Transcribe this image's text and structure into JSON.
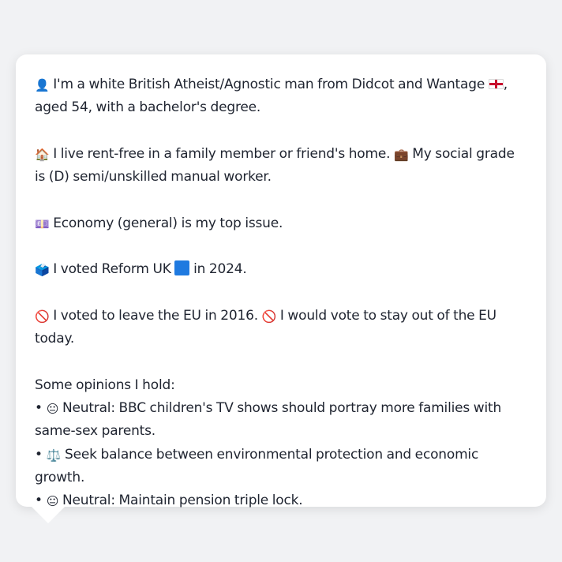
{
  "bio": {
    "p1": {
      "icon": "👤",
      "text_a": "I'm a white British Atheist/Agnostic man from Didcot and Wantage",
      "flag": "england-flag",
      "text_b": ", aged 54, with a bachelor's degree."
    },
    "p2": {
      "icon1": "🏠",
      "text_a": "I live rent-free in a family member or friend's home.",
      "icon2": "💼",
      "text_b": "My social grade is (D) semi/unskilled manual worker."
    },
    "p3": {
      "icon": "💷",
      "text": "Economy (general) is my top issue."
    },
    "p4": {
      "icon": "🗳️",
      "text_a": "I voted Reform UK",
      "square_color": "#1f7ae0",
      "text_b": "in 2024."
    },
    "p5": {
      "icon1": "🚫",
      "text_a": "I voted to leave the EU in 2016.",
      "icon2": "🚫",
      "text_b": "I would vote to stay out of the EU today."
    },
    "opinions": {
      "heading": "Some opinions I hold:",
      "items": [
        {
          "bullet": "•",
          "icon": "😐",
          "text": "Neutral: BBC children's TV shows should portray more families with same-sex parents."
        },
        {
          "bullet": "•",
          "icon": "⚖️",
          "text": "Seek balance between environmental protection and economic growth."
        },
        {
          "bullet": "•",
          "icon": "😐",
          "text": "Neutral: Maintain pension triple lock."
        }
      ]
    }
  }
}
